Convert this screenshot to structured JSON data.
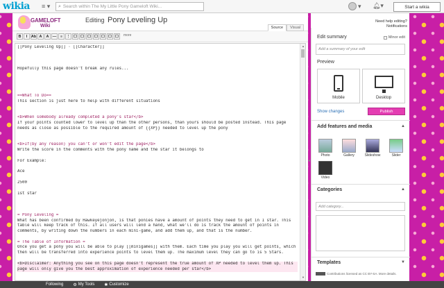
{
  "topbar": {
    "wordmark": "wikia",
    "search_placeholder": "Search within The My Little Pony Gameloft Wiki...",
    "start_wiki": "Start a wikia"
  },
  "header": {
    "logo_line1": "GAMELOFT",
    "logo_line2": "Wiki",
    "editing_prefix": "Editing",
    "page_title": "Pony Leveling Up",
    "tabs": [
      "Source",
      "Visual"
    ],
    "more_label": "more"
  },
  "toolbar": {
    "buttons": [
      "B",
      "I",
      "Ab",
      "A",
      "A",
      "—",
      "≡",
      "⋮",
      "☐",
      "☐",
      "☐",
      "☐",
      "☐",
      "☐",
      "☐"
    ]
  },
  "editor": {
    "lines": [
      {
        "t": "[[Pony Leveling Up]] · [[Character]]",
        "c": ""
      },
      {
        "t": "",
        "c": ""
      },
      {
        "t": "",
        "c": ""
      },
      {
        "t": "",
        "c": ""
      },
      {
        "t": "Hopefully this page doesn't break any rules...",
        "c": ""
      },
      {
        "t": "",
        "c": ""
      },
      {
        "t": "",
        "c": ""
      },
      {
        "t": "",
        "c": ""
      },
      {
        "t": "",
        "c": ""
      },
      {
        "t": "==What To Do==",
        "c": "pk"
      },
      {
        "t": "This section is just here to help with different situations",
        "c": ""
      },
      {
        "t": "",
        "c": ""
      },
      {
        "t": "",
        "c": ""
      },
      {
        "t": "<b>When somebody already completed a pony's star</b>",
        "c": "pk"
      },
      {
        "t": "If your points counted lower to level up than the other persons, than yours should be posted instead. This page",
        "c": ""
      },
      {
        "t": "needs as close as possible to the required amount of {{XP}} needed to level up the pony",
        "c": ""
      },
      {
        "t": "",
        "c": ""
      },
      {
        "t": "",
        "c": ""
      },
      {
        "t": "<b>If(by any reason) you can't or won't edit the page</b>",
        "c": "pk"
      },
      {
        "t": "Write the score in the comments with the pony name and the star it belongs to",
        "c": ""
      },
      {
        "t": "",
        "c": ""
      },
      {
        "t": "For Example:",
        "c": ""
      },
      {
        "t": "",
        "c": ""
      },
      {
        "t": "Ace",
        "c": ""
      },
      {
        "t": "",
        "c": ""
      },
      {
        "t": "2500",
        "c": ""
      },
      {
        "t": "",
        "c": ""
      },
      {
        "t": "1st star",
        "c": ""
      },
      {
        "t": "",
        "c": ""
      },
      {
        "t": "",
        "c": ""
      },
      {
        "t": "",
        "c": ""
      },
      {
        "t": "= Pony Leveling =",
        "c": "pk"
      },
      {
        "t": "What has been confirmed by Hawkeyejonjon, is that ponies have a amount of points they need to get in 1 star. This",
        "c": ""
      },
      {
        "t": "table will keep track of this. If all users will lend a hand, what we'll do is track the amount of points in",
        "c": ""
      },
      {
        "t": "comments, by writing down the numbers in each mini-game, and add them up, and that is the number.",
        "c": ""
      },
      {
        "t": "",
        "c": ""
      },
      {
        "t": "= The Table of Information =",
        "c": "pk"
      },
      {
        "t": "Once you get a pony you will be able to play [[minigames]] with them. Each time you play you will get points, which",
        "c": ""
      },
      {
        "t": "then will be transferred into experience points to level them up. The maximum level they can go to is 5 Stars.",
        "c": ""
      },
      {
        "t": "",
        "c": ""
      },
      {
        "t": "<b>Disclaimer: Anything you see on this page doesn't represent the true amount of XP needed to level them up. This",
        "c": "hl"
      },
      {
        "t": "page will only give you the best approximation of experience needed per star</b>",
        "c": "hl"
      }
    ]
  },
  "rail": {
    "need_help": "Need help editing?",
    "notifications": "Notifications",
    "edit_summary": "Edit summary",
    "minor_edit": "Minor edit",
    "summary_placeholder": "Add a summary of your edit",
    "preview": "Preview",
    "mobile": "Mobile",
    "desktop": "Desktop",
    "show_changes": "Show changes",
    "publish": "Publish",
    "features_heading": "Add features and media",
    "features": [
      "Photo",
      "Gallery",
      "Slideshow",
      "Slider",
      "Video"
    ],
    "categories": "Categories",
    "category_placeholder": "Add category...",
    "templates": "Templates",
    "license": "Contributions licensed as CC BY-SA. More details."
  },
  "footer": {
    "following": "Following",
    "my_tools": "My Tools",
    "customize": "Customize"
  },
  "colors": {
    "accent": "#e43db2",
    "brand_blue": "#00a0d2",
    "background": "#c81fa6"
  }
}
